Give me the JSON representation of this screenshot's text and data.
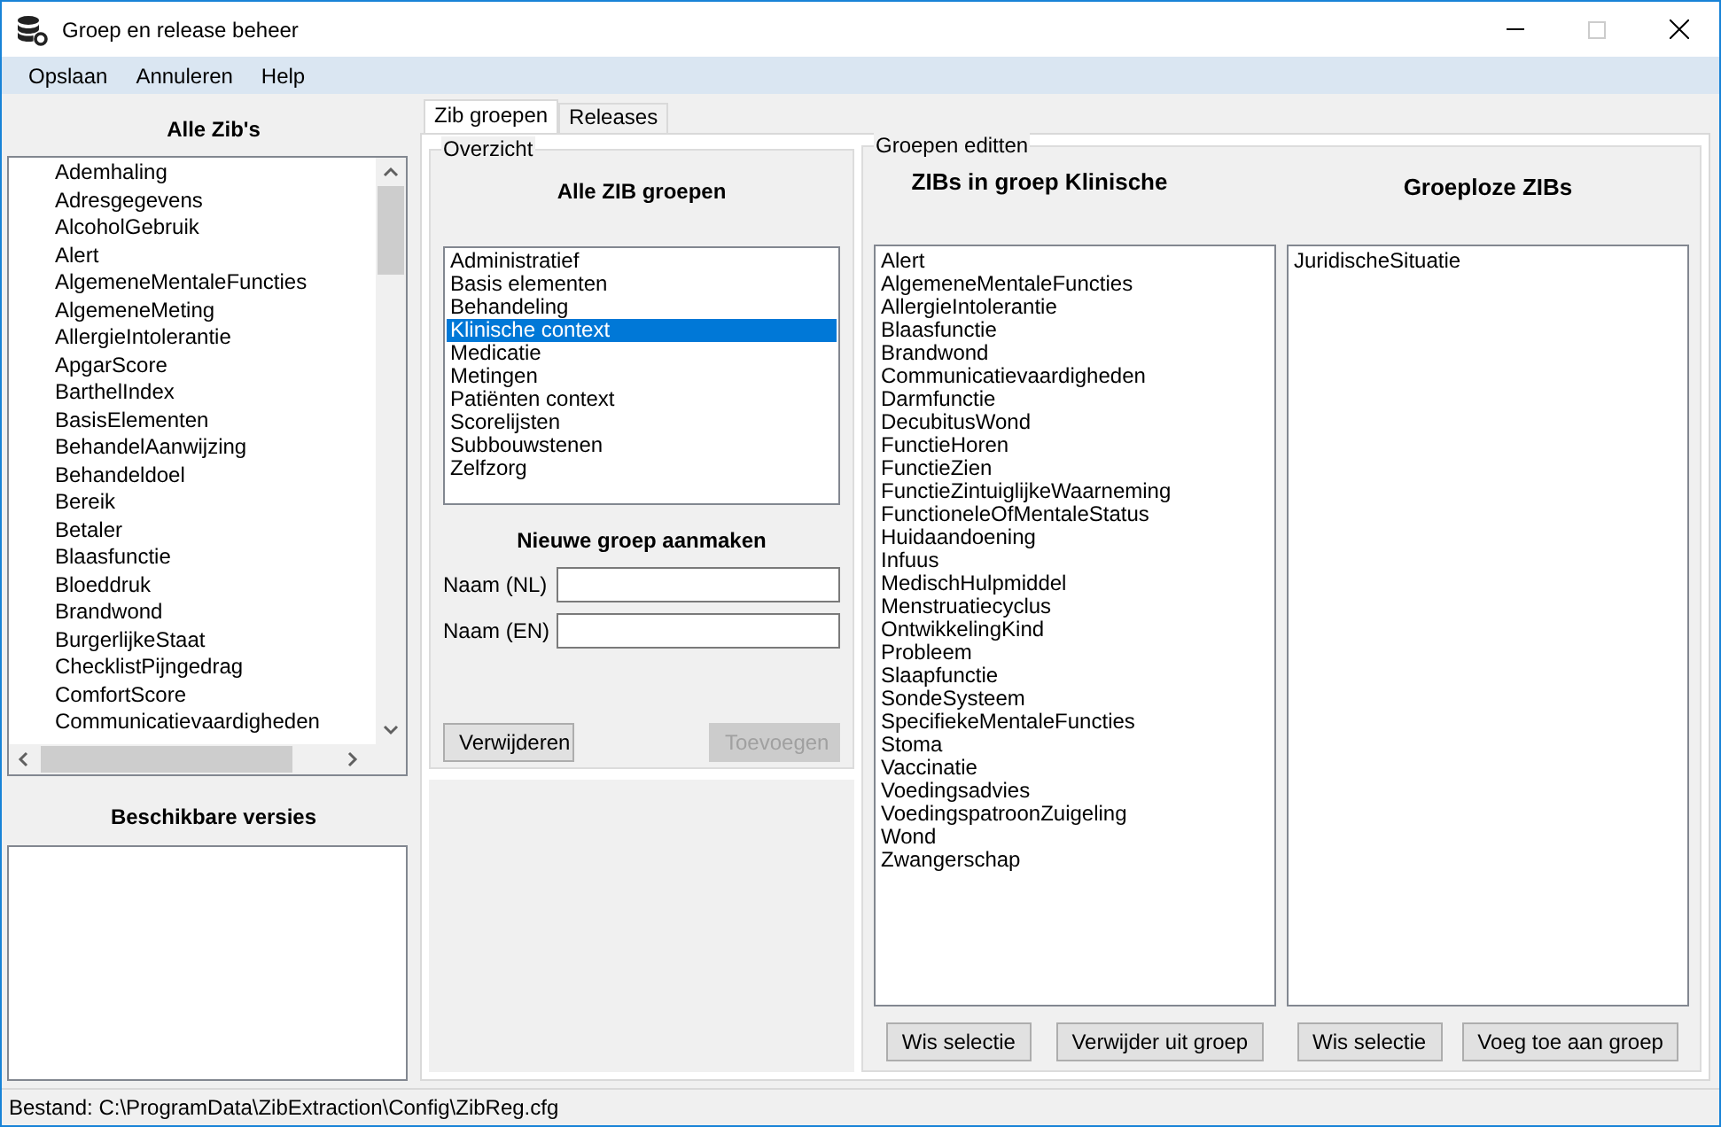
{
  "window": {
    "title": "Groep en release beheer",
    "maximize_disabled": true
  },
  "menu": [
    "Opslaan",
    "Annuleren",
    "Help"
  ],
  "all_zibs": {
    "title": "Alle Zib's",
    "items": [
      "Ademhaling",
      "Adresgegevens",
      "AlcoholGebruik",
      "Alert",
      "AlgemeneMentaleFuncties",
      "AlgemeneMeting",
      "AllergieIntolerantie",
      "ApgarScore",
      "BarthelIndex",
      "BasisElementen",
      "BehandelAanwijzing",
      "Behandeldoel",
      "Bereik",
      "Betaler",
      "Blaasfunctie",
      "Bloeddruk",
      "Brandwond",
      "BurgerlijkeStaat",
      "ChecklistPijngedrag",
      "ComfortScore",
      "Communicatievaardigheden"
    ]
  },
  "versions": {
    "title": "Beschikbare versies"
  },
  "tabs": [
    {
      "label": "Zib groepen",
      "selected": true
    },
    {
      "label": "Releases",
      "selected": false
    }
  ],
  "overview": {
    "legend": "Overzicht",
    "title": "Alle ZIB groepen",
    "groups": [
      {
        "label": "Administratief",
        "selected": false
      },
      {
        "label": "Basis elementen",
        "selected": false
      },
      {
        "label": "Behandeling",
        "selected": false
      },
      {
        "label": "Klinische context",
        "selected": true
      },
      {
        "label": "Medicatie",
        "selected": false
      },
      {
        "label": "Metingen",
        "selected": false
      },
      {
        "label": "Patiënten context",
        "selected": false
      },
      {
        "label": "Scorelijsten",
        "selected": false
      },
      {
        "label": "Subbouwstenen",
        "selected": false
      },
      {
        "label": "Zelfzorg",
        "selected": false
      }
    ],
    "new_group_title": "Nieuwe groep aanmaken",
    "fields": [
      {
        "label": "Naam (NL)"
      },
      {
        "label": "Naam (EN)"
      }
    ],
    "buttons": [
      {
        "label": "Verwijderen",
        "disabled": false
      },
      {
        "label": "Toevoegen",
        "disabled": true
      }
    ]
  },
  "edit": {
    "legend": "Groepen editten",
    "in_group": {
      "title": "ZIBs in groep Klinische",
      "items": [
        "Alert",
        "AlgemeneMentaleFuncties",
        "AllergieIntolerantie",
        "Blaasfunctie",
        "Brandwond",
        "Communicatievaardigheden",
        "Darmfunctie",
        "DecubitusWond",
        "FunctieHoren",
        "FunctieZien",
        "FunctieZintuiglijkeWaarneming",
        "FunctioneleOfMentaleStatus",
        "Huidaandoening",
        "Infuus",
        "MedischHulpmiddel",
        "Menstruatiecyclus",
        "OntwikkelingKind",
        "Probleem",
        "Slaapfunctie",
        "SondeSysteem",
        "SpecifiekeMentaleFuncties",
        "Stoma",
        "Vaccinatie",
        "Voedingsadvies",
        "VoedingspatroonZuigeling",
        "Wond",
        "Zwangerschap"
      ],
      "buttons": [
        "Wis selectie",
        "Verwijder uit groep"
      ]
    },
    "ungrouped": {
      "title": "Groeploze ZIBs",
      "items": [
        "JuridischeSituatie"
      ],
      "buttons": [
        "Wis selectie",
        "Voeg toe aan groep"
      ]
    }
  },
  "status_bar": "Bestand: C:\\ProgramData\\ZibExtraction\\Config\\ZibReg.cfg"
}
